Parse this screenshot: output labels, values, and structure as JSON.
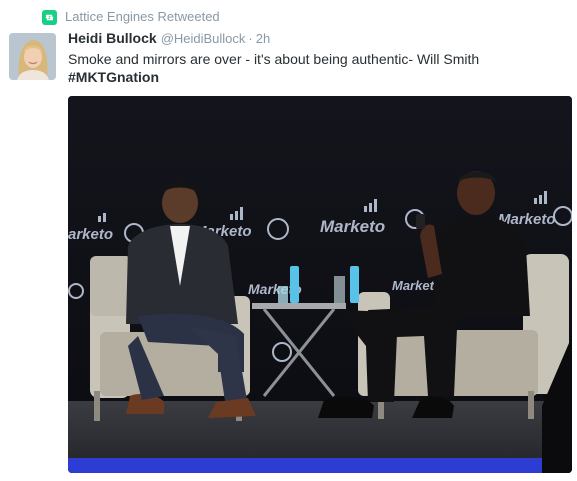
{
  "retweet_context": {
    "icon": "retweet-icon",
    "text": "Lattice Engines Retweeted"
  },
  "tweet": {
    "author": {
      "fullname": "Heidi Bullock",
      "username": "@HeidiBullock"
    },
    "separator": "·",
    "time": "2h",
    "text": "Smoke and mirrors are over - it's about being authentic- Will Smith",
    "hashtag": "#MKTGnation"
  },
  "media": {
    "stage_signs": [
      "Marketo",
      "Marketo",
      "Marketo",
      "Marketo",
      "Marketo"
    ],
    "left_sign": "arketo",
    "colors": {
      "backdrop": "#101117",
      "stage": "#2b2d33",
      "chair": "#c9c4b8",
      "accent_blue": "#2d3cd3"
    }
  },
  "colors": {
    "retweet_green": "#19cf86",
    "text": "#292f33",
    "muted": "#8899a6"
  }
}
